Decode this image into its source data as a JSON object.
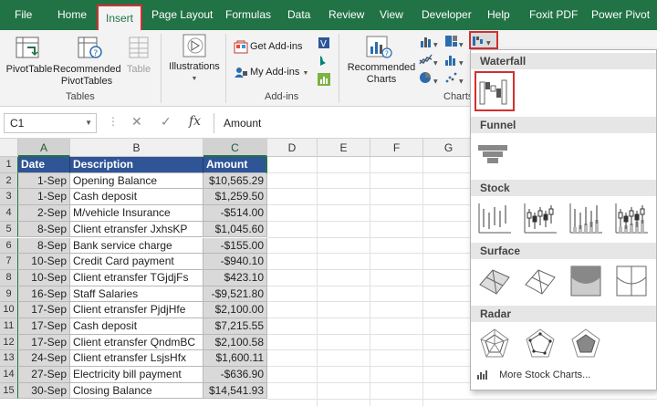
{
  "menu": {
    "tabs": [
      {
        "label": "File"
      },
      {
        "label": "Home"
      },
      {
        "label": "Insert"
      },
      {
        "label": "Page Layout"
      },
      {
        "label": "Formulas"
      },
      {
        "label": "Data"
      },
      {
        "label": "Review"
      },
      {
        "label": "View"
      },
      {
        "label": "Developer"
      },
      {
        "label": "Help"
      },
      {
        "label": "Foxit PDF"
      },
      {
        "label": "Power Pivot"
      }
    ],
    "active": "Insert"
  },
  "ribbon": {
    "pivot_table": "PivotTable",
    "recommended_pivot_line1": "Recommended",
    "recommended_pivot_line2": "PivotTables",
    "table": "Table",
    "tables_group": "Tables",
    "illustrations": "Illustrations",
    "get_addins": "Get Add-ins",
    "my_addins": "My Add-ins",
    "addins_group": "Add-ins",
    "recommended_charts_line1": "Recommended",
    "recommended_charts_line2": "Charts",
    "charts_group": "Charts"
  },
  "formula_bar": {
    "name_box": "C1",
    "fx": "fx",
    "content": "Amount"
  },
  "columns": [
    "A",
    "B",
    "C",
    "D",
    "E",
    "F",
    "G"
  ],
  "sheet": {
    "headers": {
      "date": "Date",
      "description": "Description",
      "amount": "Amount"
    },
    "rows": [
      {
        "n": "1"
      },
      {
        "n": "2",
        "date": "1-Sep",
        "desc": "Opening Balance",
        "amount": "$10,565.29"
      },
      {
        "n": "3",
        "date": "1-Sep",
        "desc": "Cash deposit",
        "amount": "$1,259.50"
      },
      {
        "n": "4",
        "date": "2-Sep",
        "desc": "M/vehicle Insurance",
        "amount": "-$514.00"
      },
      {
        "n": "5",
        "date": "8-Sep",
        "desc": "Client etransfer JxhsKP",
        "amount": "$1,045.60"
      },
      {
        "n": "6",
        "date": "8-Sep",
        "desc": "Bank service charge",
        "amount": "-$155.00"
      },
      {
        "n": "7",
        "date": "10-Sep",
        "desc": "Credit Card payment",
        "amount": "-$940.10"
      },
      {
        "n": "8",
        "date": "10-Sep",
        "desc": "Client etransfer TGjdjFs",
        "amount": "$423.10"
      },
      {
        "n": "9",
        "date": "16-Sep",
        "desc": "Staff Salaries",
        "amount": "-$9,521.80"
      },
      {
        "n": "10",
        "date": "17-Sep",
        "desc": "Client etransfer PjdjHfe",
        "amount": "$2,100.00"
      },
      {
        "n": "11",
        "date": "17-Sep",
        "desc": "Cash deposit",
        "amount": "$7,215.55"
      },
      {
        "n": "12",
        "date": "17-Sep",
        "desc": "Client etransfer QndmBC",
        "amount": "$2,100.58"
      },
      {
        "n": "13",
        "date": "24-Sep",
        "desc": "Client etransfer LsjsHfx",
        "amount": "$1,600.11"
      },
      {
        "n": "14",
        "date": "27-Sep",
        "desc": "Electricity bill payment",
        "amount": "-$636.90"
      },
      {
        "n": "15",
        "date": "30-Sep",
        "desc": "Closing Balance",
        "amount": "$14,541.93"
      }
    ]
  },
  "dropdown": {
    "sections": [
      {
        "label": "Waterfall"
      },
      {
        "label": "Funnel"
      },
      {
        "label": "Stock"
      },
      {
        "label": "Surface"
      },
      {
        "label": "Radar"
      }
    ],
    "more": "More Stock Charts..."
  },
  "colors": {
    "accent": "#217346",
    "selection": "#d32f2f",
    "header_fill": "#2f5597"
  }
}
